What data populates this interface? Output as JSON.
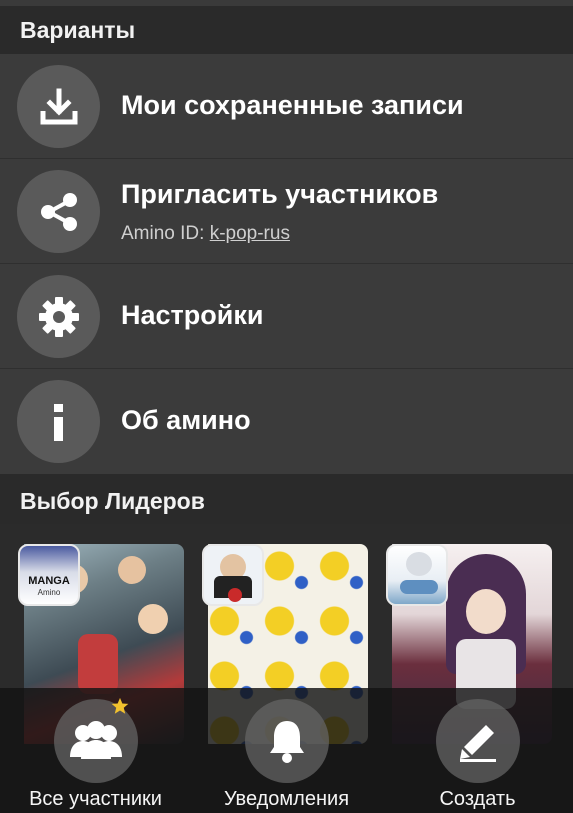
{
  "options_header": "Варианты",
  "menu": [
    {
      "icon": "download-icon",
      "title": "Мои сохраненные записи"
    },
    {
      "icon": "share-icon",
      "title": "Пригласить участников",
      "sub_prefix": "Amino ID:",
      "sub_value": "k-pop-rus"
    },
    {
      "icon": "gear-icon",
      "title": "Настройки"
    },
    {
      "icon": "info-icon",
      "title": "Об амино"
    }
  ],
  "leaders_header": "Выбор Лидеров",
  "cards": [
    {
      "avatar_text": "MANGA",
      "avatar_sub": "Amino"
    },
    {
      "avatar_text": "",
      "avatar_sub": ""
    },
    {
      "avatar_text": "",
      "avatar_sub": ""
    }
  ],
  "tabs": [
    {
      "icon": "members-icon",
      "label": "Все участники"
    },
    {
      "icon": "bell-icon",
      "label": "Уведомления"
    },
    {
      "icon": "pencil-icon",
      "label": "Создать"
    }
  ],
  "colors": {
    "accent_star": "#f2c12e",
    "background": "#2b2b2b",
    "row": "#3b3b3b"
  }
}
